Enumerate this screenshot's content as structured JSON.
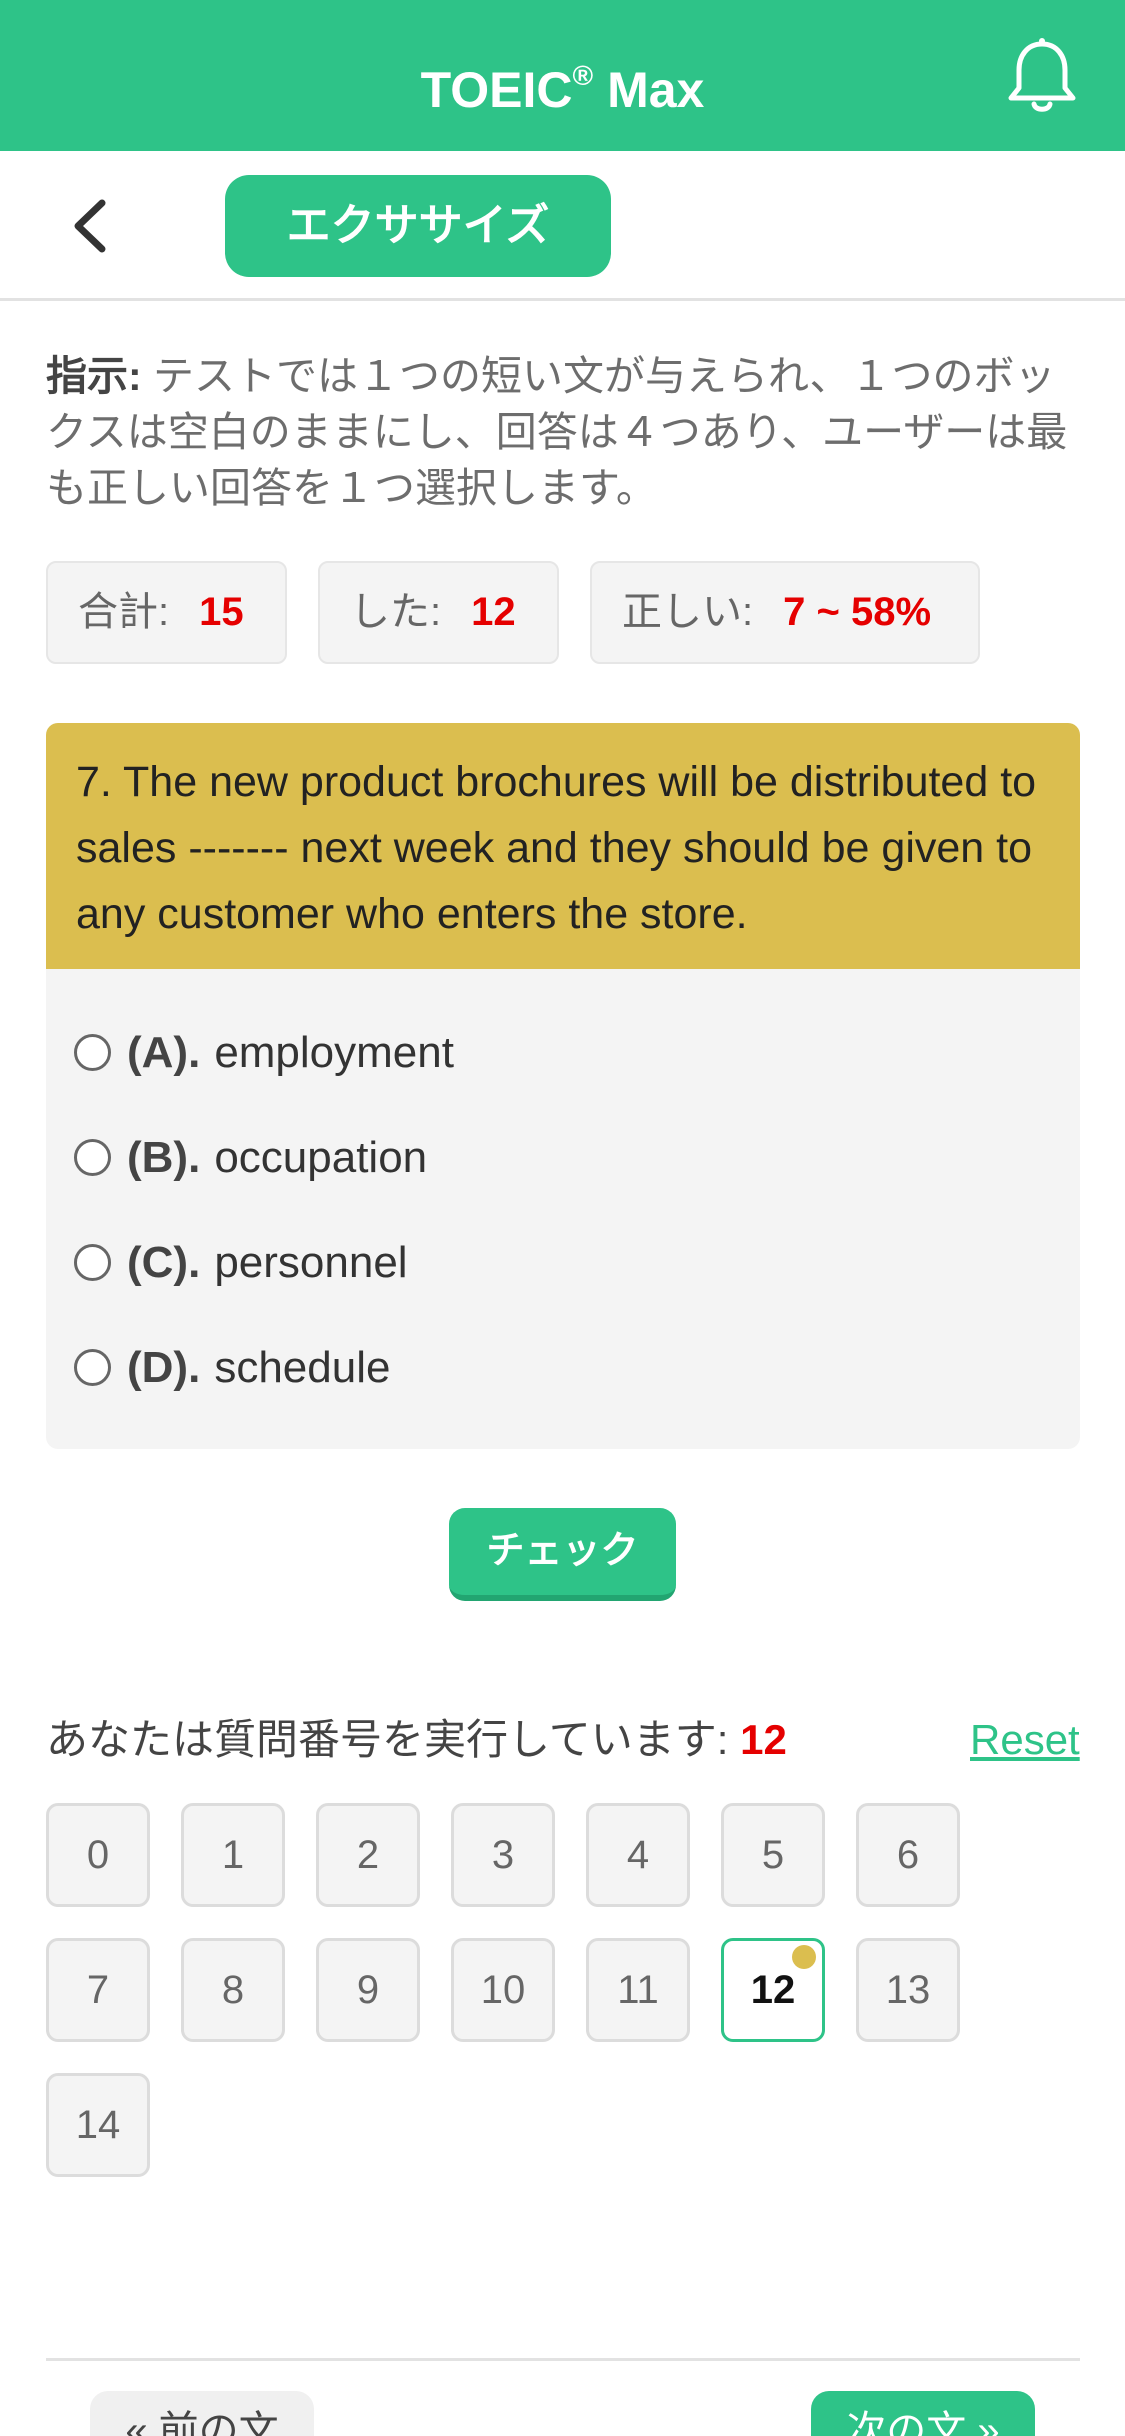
{
  "header": {
    "title_main": "TOEIC",
    "title_reg": "®",
    "title_suffix": " Max",
    "bell_icon": "bell-icon"
  },
  "subbar": {
    "back_icon": "chevron-left-icon",
    "exercise_label": "エクササイズ"
  },
  "instruction": {
    "label": "指示:",
    "text": " テストでは１つの短い文が与えられ、１つのボックスは空白のままにし、回答は４つあり、ユーザーは最も正しい回答を１つ選択します。"
  },
  "stats": [
    {
      "label": "合計:",
      "value": "15"
    },
    {
      "label": "した:",
      "value": "12"
    },
    {
      "label": "正しい:",
      "value": "7 ~ 58%"
    }
  ],
  "question": {
    "text": "7. The new product brochures will be distributed to sales ------- next week and they should be given to any customer who enters the store.",
    "options": [
      {
        "key": "(A).",
        "text": "employment"
      },
      {
        "key": "(B).",
        "text": "occupation"
      },
      {
        "key": "(C).",
        "text": "personnel"
      },
      {
        "key": "(D).",
        "text": "schedule"
      }
    ]
  },
  "check_label": "チェック",
  "progress": {
    "label": "あなたは質問番号を実行しています: ",
    "current": "12",
    "reset_label": "Reset",
    "numbers": [
      "0",
      "1",
      "2",
      "3",
      "4",
      "5",
      "6",
      "7",
      "8",
      "9",
      "10",
      "11",
      "12",
      "13",
      "14"
    ],
    "active_index": 12
  },
  "nav": {
    "prev_label": "« 前の文",
    "next_label": "次の文 »"
  },
  "colors": {
    "primary": "#2ec388",
    "question_bg": "#dbbe4f",
    "highlight_red": "#e50000"
  }
}
